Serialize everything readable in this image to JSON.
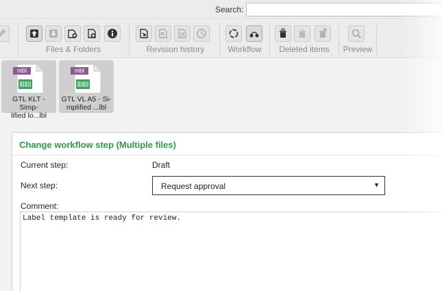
{
  "search": {
    "label": "Search:",
    "value": "",
    "placeholder": ""
  },
  "toolbar": {
    "groups": [
      {
        "label": "Files & Folders"
      },
      {
        "label": "Revision history"
      },
      {
        "label": "Workflow"
      },
      {
        "label": "Deleted items"
      },
      {
        "label": "Preview"
      }
    ],
    "icons": {
      "edit": "edit-icon",
      "upload": "upload-icon",
      "download": "download-icon",
      "new_file": "new-file-icon",
      "new_folder": "new-folder-icon",
      "info": "info-icon",
      "checkout": "checkout-icon",
      "checkin": "checkin-icon",
      "undo_checkout": "undo-checkout-icon",
      "history": "history-icon",
      "workflow_refresh": "workflow-refresh-icon",
      "workflow_step": "workflow-step-icon",
      "deleted": "deleted-items-icon",
      "restore": "restore-icon",
      "purge": "purge-icon",
      "preview": "preview-icon"
    }
  },
  "files": [
    {
      "badge": "nibl",
      "name_line1": "GTL KLT - Simp-",
      "name_line2": "lified lo...lbl"
    },
    {
      "badge": "nibl",
      "name_line1": "GTL VL A5 - Si-",
      "name_line2": "mplified ...lbl"
    }
  ],
  "dialog": {
    "title": "Change workflow step (Multiple files)",
    "current_step_label": "Current step:",
    "current_step_value": "Draft",
    "next_step_label": "Next step:",
    "next_step_value": "Request approval",
    "comment_label": "Comment:",
    "comment_value": "Label template is ready for review."
  },
  "colors": {
    "accent": "#2e9b47",
    "file_badge": "#8e5a8e",
    "barcode": "#3aa35a"
  }
}
